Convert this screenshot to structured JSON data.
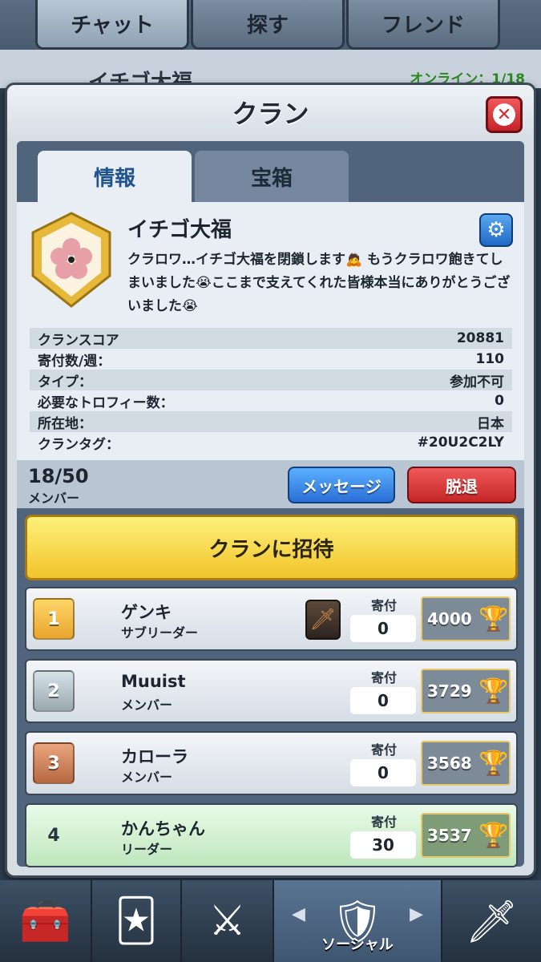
{
  "top_tabs": [
    "チャット",
    "探す",
    "フレンド"
  ],
  "background": {
    "clan_name": "イチゴ大福",
    "online": "オンライン：1/18"
  },
  "modal": {
    "title": "クラン",
    "tabs": [
      "情報",
      "宝箱"
    ]
  },
  "clan": {
    "name": "イチゴ大福",
    "description": "クラロワ…イチゴ大福を閉鎖します🙇 もうクラロワ飽きてしまいました😭ここまで支えてくれた皆様本当にありがとうございました😭"
  },
  "stats": [
    {
      "label": "クランスコア",
      "value": "20881"
    },
    {
      "label": "寄付数/週：",
      "value": "110"
    },
    {
      "label": "タイプ：",
      "value": "参加不可"
    },
    {
      "label": "必要なトロフィー数：",
      "value": "0"
    },
    {
      "label": "所在地：",
      "value": "日本"
    },
    {
      "label": "クランタグ：",
      "value": "#20U2C2LY"
    }
  ],
  "members_summary": {
    "count": "18/50",
    "label": "メンバー",
    "message_btn": "メッセージ",
    "leave_btn": "脱退"
  },
  "invite_btn": "クランに招待",
  "members": [
    {
      "rank": "1",
      "name": "ゲンキ",
      "role": "サブリーダー",
      "donation_label": "寄付",
      "donations": "0",
      "trophies": "4000"
    },
    {
      "rank": "2",
      "name": "Muuist",
      "role": "メンバー",
      "donation_label": "寄付",
      "donations": "0",
      "trophies": "3729"
    },
    {
      "rank": "3",
      "name": "カローラ",
      "role": "メンバー",
      "donation_label": "寄付",
      "donations": "0",
      "trophies": "3568"
    },
    {
      "rank": "4",
      "name": "かんちゃん",
      "role": "リーダー",
      "donation_label": "寄付",
      "donations": "30",
      "trophies": "3537"
    }
  ],
  "bottom_nav": {
    "social_label": "ソーシャル"
  },
  "colors": {
    "accent_yellow": "#f2c42a",
    "accent_blue": "#2a6fd6",
    "accent_red": "#c42626"
  }
}
